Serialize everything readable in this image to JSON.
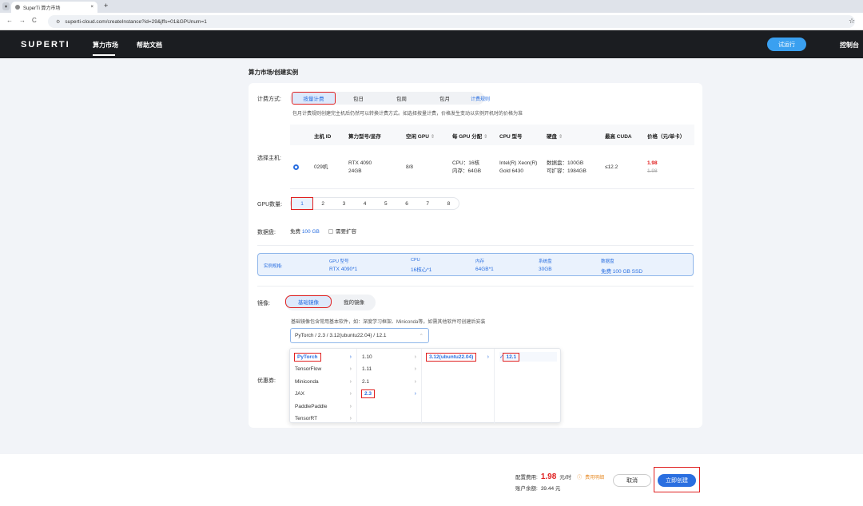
{
  "browser": {
    "tab_title": "SuperTi 算力市场",
    "url": "superti-cloud.com/createInstance?id=29&jffs=01&GPUnum=1",
    "new_tab": "+",
    "back": "←",
    "forward": "→",
    "reload": "C",
    "star": "☆"
  },
  "header": {
    "logo": "SUPERTI",
    "nav": [
      "算力市场",
      "帮助文档"
    ],
    "try_button": "试运行",
    "console": "控制台"
  },
  "breadcrumb": "算力市场/创建实例",
  "billing": {
    "label": "计费方式:",
    "options": [
      "按量计费",
      "包日",
      "包周",
      "包月"
    ],
    "rules_link": "计费规则",
    "hint": "包月计费规则创建完主机后仍然可以转换计费方式。如选择按量计费，价格发生变动以实例开机时的价格为准"
  },
  "host": {
    "label": "选择主机:",
    "headers": [
      "主机 ID",
      "算力型号/显存",
      "空闲 GPU",
      "每 GPU 分配",
      "CPU 型号",
      "硬盘",
      "最高 CUDA",
      "价格（元/单卡）"
    ],
    "row": {
      "id": "029机",
      "model": "RTX 4090",
      "vram": "24GB",
      "free_gpu": "8/8",
      "alloc_cpu": "CPU：16核",
      "alloc_mem": "内存：64GB",
      "cpu_model1": "Intel(R) Xeon(R)",
      "cpu_model2": "Gold 6430",
      "disk1": "数据盘：100GB",
      "disk2": "可扩容：1984GB",
      "cuda": "≤12.2",
      "price": "1.98",
      "price_old": "1.98"
    }
  },
  "gpu_count": {
    "label": "GPU数量:",
    "options": [
      "1",
      "2",
      "3",
      "4",
      "5",
      "6",
      "7",
      "8"
    ]
  },
  "data_disk": {
    "label": "数据盘:",
    "free": "免费 100 GB",
    "expand": "需要扩容"
  },
  "summary": {
    "label": "实例规格:",
    "items": [
      {
        "k": "GPU 型号",
        "v": "RTX 4090*1"
      },
      {
        "k": "CPU",
        "v": "16核心*1"
      },
      {
        "k": "内存",
        "v": "64GB*1"
      },
      {
        "k": "系统盘",
        "v": "30GB"
      },
      {
        "k": "数据盘",
        "v": "免费 100 GB SSD"
      }
    ]
  },
  "image": {
    "label": "镜像:",
    "tabs": [
      "基础镜像",
      "我的镜像"
    ],
    "hint": "基础镜像包含常用基本软件，如：深度学习框架、Miniconda等。如需其他软件可创建后安装",
    "selected": "PyTorch / 2.3 / 3.12(ubuntu22.04) / 12.1",
    "frameworks": [
      "PyTorch",
      "TensorFlow",
      "Miniconda",
      "JAX",
      "PaddlePaddle",
      "TensorRT"
    ],
    "versions": [
      "1.10",
      "1.11",
      "2.1",
      "2.3"
    ],
    "python": [
      "3.12(ubuntu22.04)"
    ],
    "cuda": [
      "12.1"
    ]
  },
  "coupon": {
    "label": "优惠券:"
  },
  "footer": {
    "cost_label": "配置费用:",
    "cost": "1.98",
    "unit": "元/时",
    "detail": "费用明细",
    "balance_label": "账户余额:",
    "balance": "39.44 元",
    "cancel": "取消",
    "create": "立即创建"
  },
  "colors": {
    "accent": "#2a6fe0",
    "price": "#e02020",
    "highlight": "#e02020"
  }
}
